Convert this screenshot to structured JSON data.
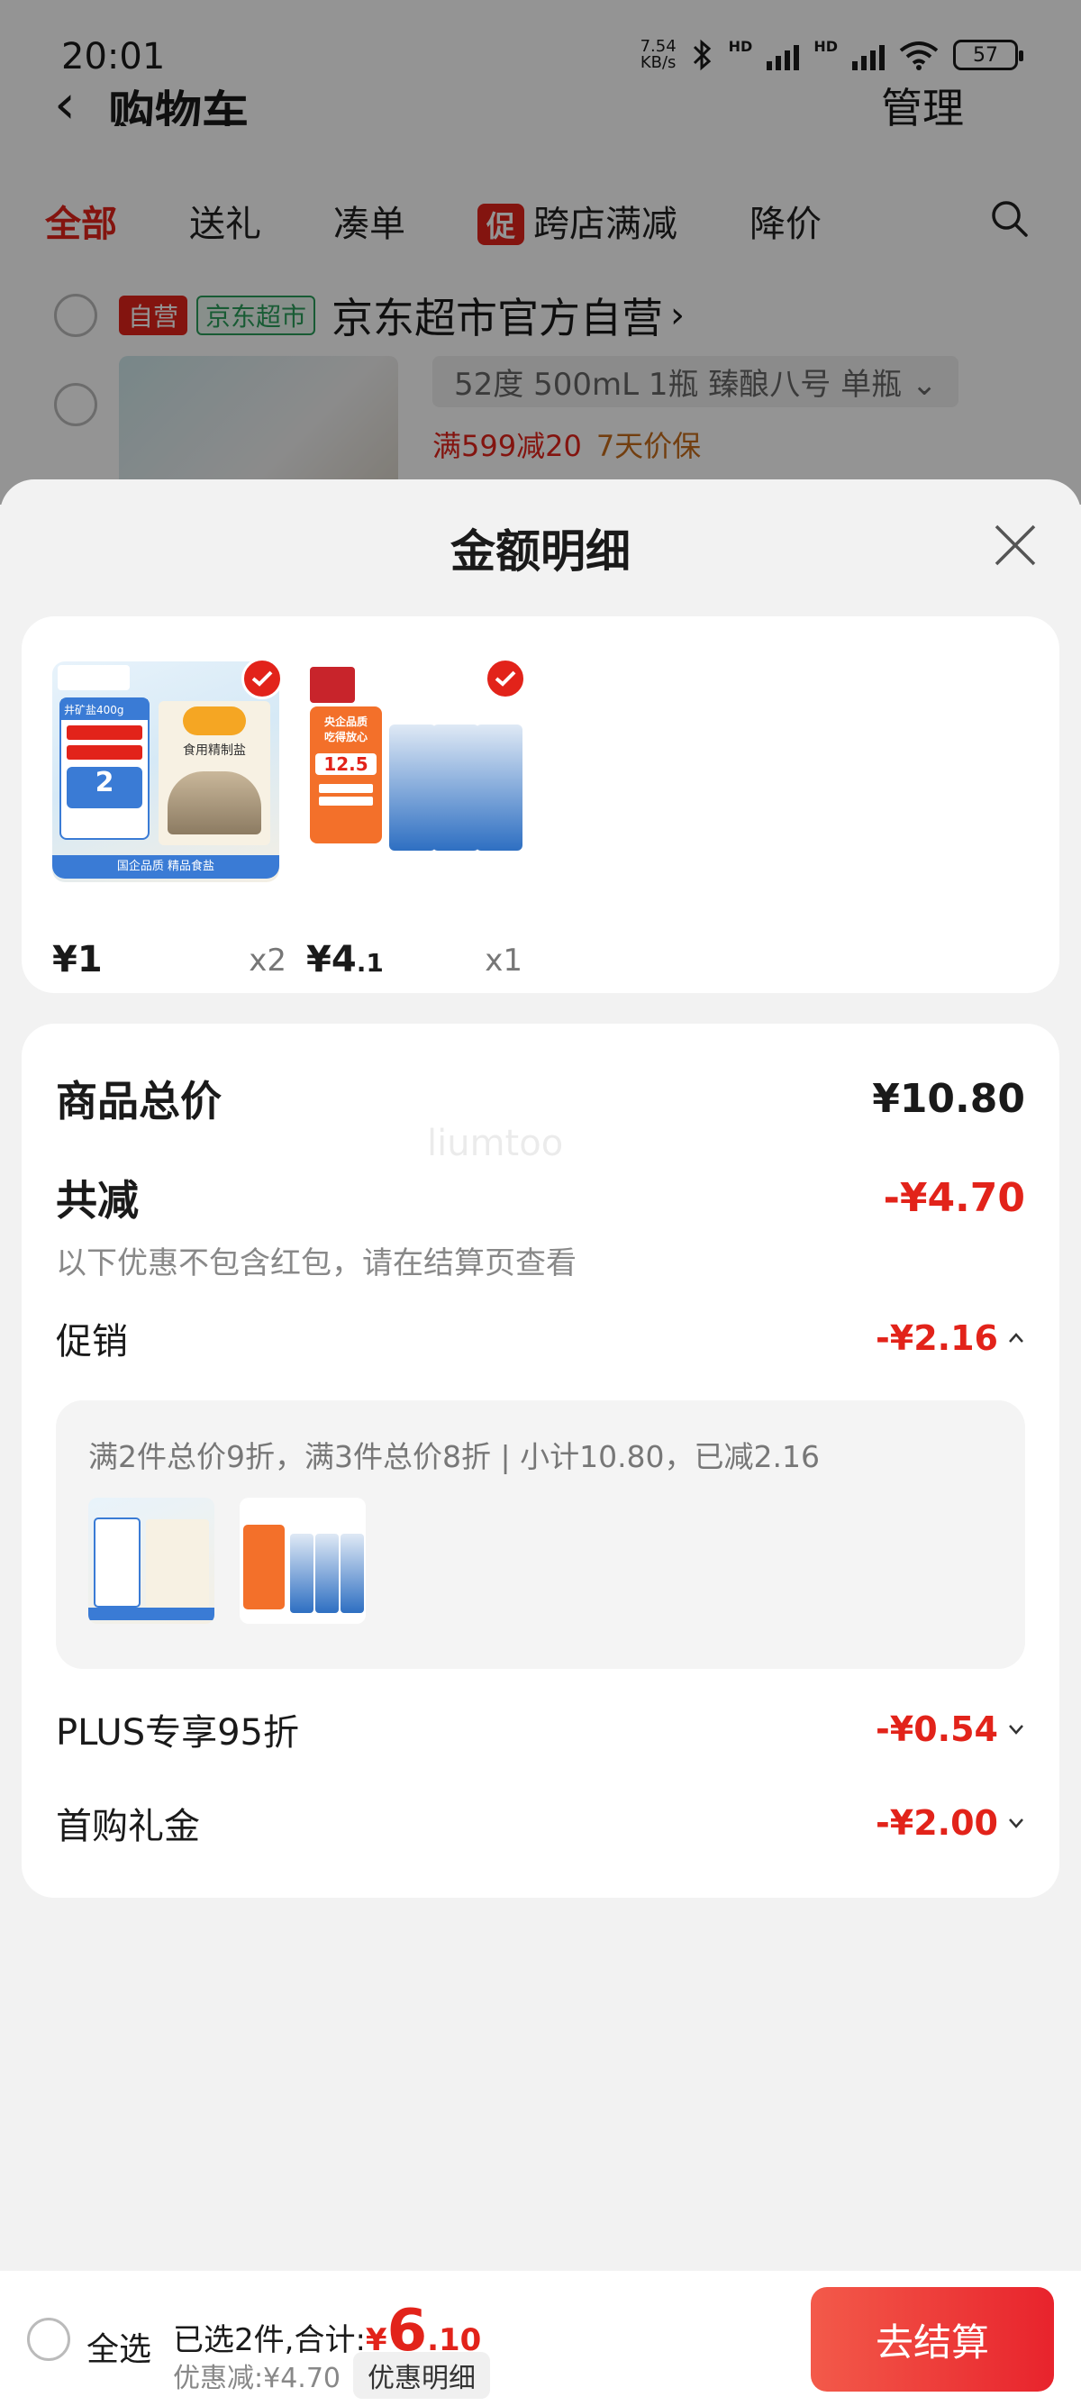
{
  "status_bar": {
    "time": "20:01",
    "net_speed_value": "7.54",
    "net_speed_unit": "KB/s",
    "hd1": "HD",
    "hd2": "HD",
    "battery": "57"
  },
  "cart_header": {
    "title": "购物车",
    "manage": "管理"
  },
  "tabs": [
    {
      "label": "全部",
      "active": true
    },
    {
      "label": "送礼"
    },
    {
      "label": "凑单"
    },
    {
      "badge": "促",
      "label": "跨店满减"
    },
    {
      "label": "降价"
    }
  ],
  "shop": {
    "tag_self": "自营",
    "tag_market": "京东超市",
    "name": "京东超市官方自营",
    "arrow": "›"
  },
  "bg_product": {
    "spec": "52度 500mL 1瓶 臻酿八号 单瓶",
    "promo": "满599减20",
    "guarantee": "7天价保"
  },
  "sheet": {
    "title": "金额明细",
    "items": [
      {
        "price_symbol": "¥",
        "price": "1",
        "qty": "x2",
        "thumb_text_1": "井矿盐400g",
        "thumb_text_2": "食用精制盐",
        "thumb_price": "2",
        "thumb_foot": "国企品质 精品食盐"
      },
      {
        "price_symbol": "¥",
        "price_int": "4",
        "price_dec": ".1",
        "qty": "x1",
        "thumb_text_1": "央企品质",
        "thumb_text_2": "吃得放心",
        "thumb_price": "12.5"
      }
    ],
    "summary": {
      "total_label": "商品总价",
      "total_value": "¥10.80",
      "discount_label": "共减",
      "discount_value": "-¥4.70",
      "note": "以下优惠不包含红包，请在结算页查看",
      "watermark": "liumtoo"
    },
    "promotion": {
      "label": "促销",
      "value": "-¥2.16",
      "detail": "满2件总价9折，满3件总价8折 | 小计10.80，已减2.16"
    },
    "plus": {
      "label": "PLUS专享95折",
      "value": "-¥0.54"
    },
    "first_purchase": {
      "label": "首购礼金",
      "value": "-¥2.00"
    }
  },
  "bottom_bar": {
    "select_all": "全选",
    "selected_prefix": "已选2件,合计:",
    "currency": "¥",
    "amount_int": "6",
    "amount_dec": ".10",
    "saved": "优惠减:¥4.70",
    "detail_button": "优惠明细",
    "checkout": "去结算"
  },
  "colors": {
    "accent": "#e2231a",
    "green": "#2a9d5b"
  }
}
